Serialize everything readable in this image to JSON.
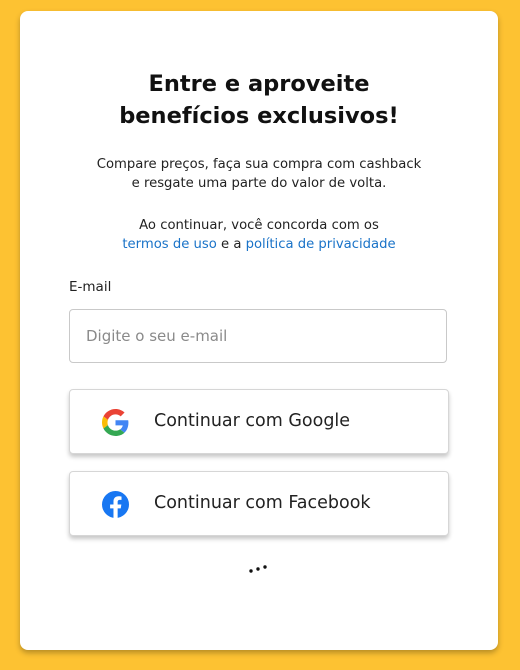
{
  "login": {
    "title_line1": "Entre e aproveite",
    "title_line2": "benefícios exclusivos!",
    "subtitle_line1": "Compare preços, faça sua compra com cashback",
    "subtitle_line2": "e resgate uma parte do valor de volta.",
    "terms_prefix": "Ao continuar, você concorda com os",
    "terms_link": "termos de uso",
    "terms_conjunction": " e a ",
    "privacy_link": "política de privacidade",
    "email_label": "E-mail",
    "email_placeholder": "Digite o seu e-mail",
    "email_value": "",
    "google_button_label": "Continuar com Google",
    "facebook_button_label": "Continuar com Facebook"
  },
  "icons": {
    "google": "google-icon",
    "facebook": "facebook-icon",
    "more": "more-dots-icon"
  },
  "colors": {
    "background": "#fdc232",
    "card": "#ffffff",
    "link": "#1a73c8",
    "facebook_blue": "#1877f2"
  }
}
